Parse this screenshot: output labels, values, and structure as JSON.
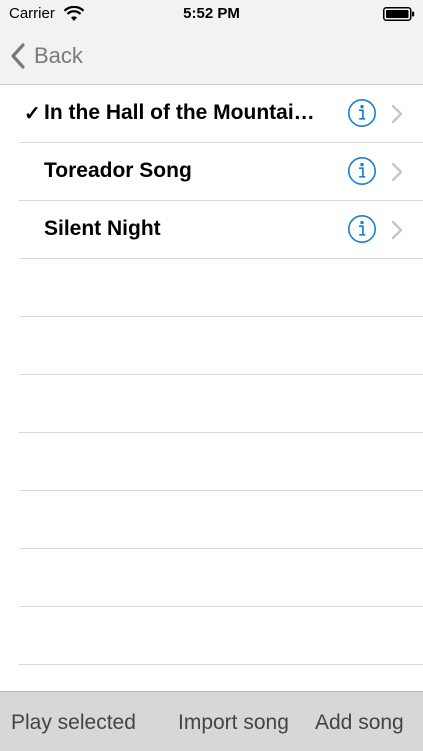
{
  "status_bar": {
    "carrier": "Carrier",
    "time": "5:52 PM",
    "wifi_icon": "wifi-icon",
    "battery_icon": "battery-icon"
  },
  "nav": {
    "back_label": "Back",
    "back_icon": "chevron-left-icon"
  },
  "songs": [
    {
      "title": "In the Hall of the Mountai…",
      "selected": true,
      "check": "✓"
    },
    {
      "title": "Toreador Song",
      "selected": false,
      "check": ""
    },
    {
      "title": "Silent Night",
      "selected": false,
      "check": ""
    }
  ],
  "empty_rows": 7,
  "toolbar": {
    "play_selected": "Play selected",
    "import_song": "Import song",
    "add_song": "Add song"
  },
  "colors": {
    "accent": "#1b7fd6",
    "nav_background": "#f2f2f2",
    "toolbar_background": "#d7d7d7",
    "separator": "#d9d9d9"
  }
}
